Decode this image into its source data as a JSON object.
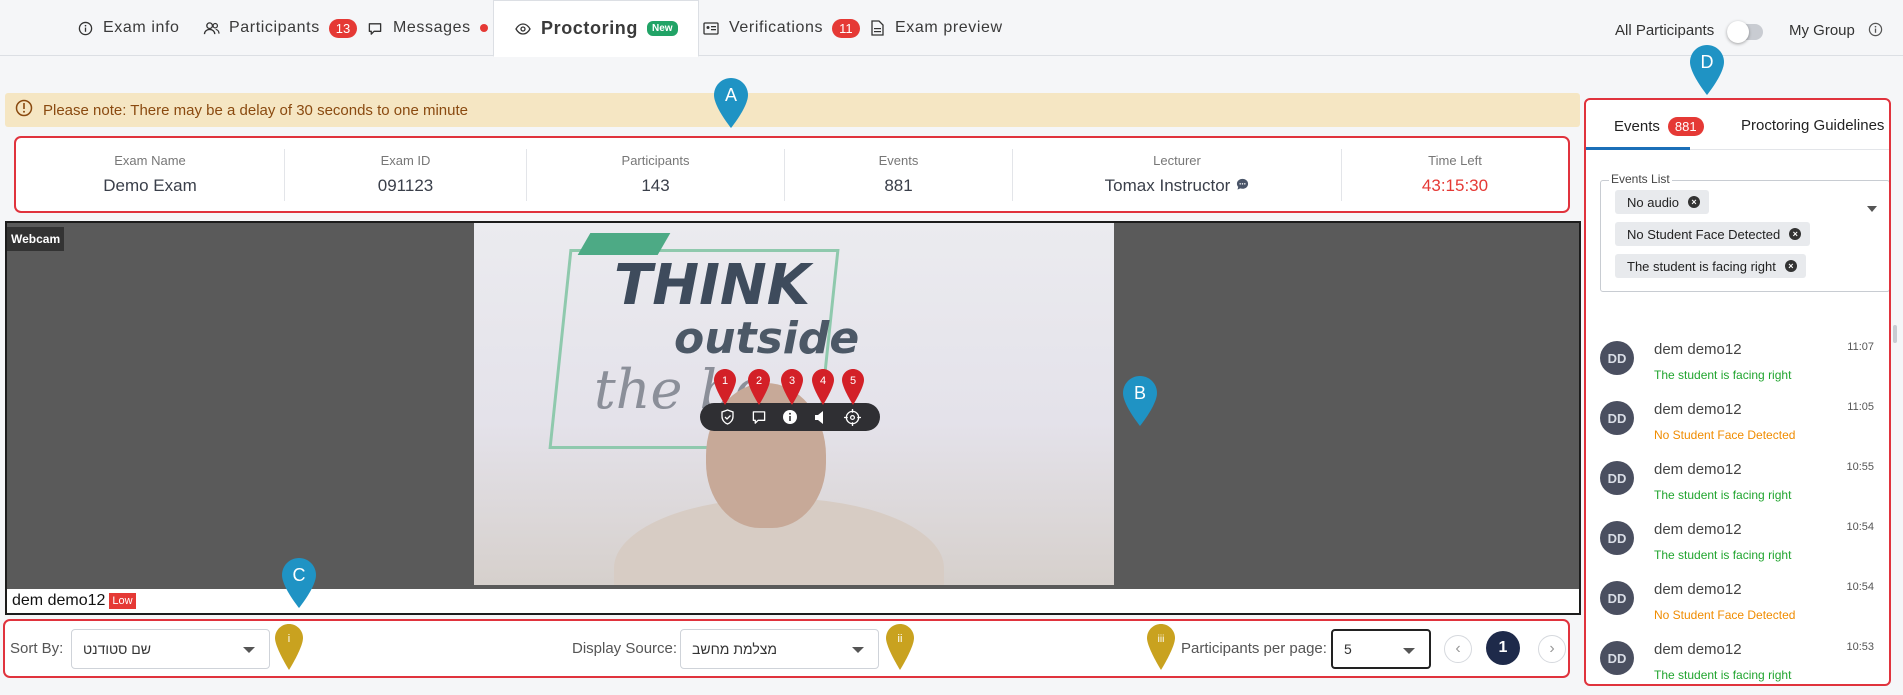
{
  "nav": {
    "tabs": [
      {
        "label": "Exam info",
        "icon": "info-circle-icon"
      },
      {
        "label": "Participants",
        "icon": "users-icon",
        "badge": "13"
      },
      {
        "label": "Messages",
        "icon": "chat-icon",
        "dot": true
      },
      {
        "label": "Proctoring",
        "icon": "eye-icon",
        "badge": "New",
        "active": true
      },
      {
        "label": "Verifications",
        "icon": "id-card-icon",
        "badge": "11"
      },
      {
        "label": "Exam preview",
        "icon": "document-icon"
      }
    ],
    "toggle_left": "All Participants",
    "toggle_right": "My Group"
  },
  "notice": {
    "text": "Please note: There may be a delay of 30 seconds to one minute"
  },
  "exam": {
    "name_label": "Exam Name",
    "name": "Demo Exam",
    "id_label": "Exam ID",
    "id": "091123",
    "participants_label": "Participants",
    "participants": "143",
    "events_label": "Events",
    "events": "881",
    "lecturer_label": "Lecturer",
    "lecturer": "Tomax Instructor",
    "time_label": "Time Left",
    "time_left": "43:15:30"
  },
  "webcam": {
    "tag": "Webcam",
    "student_name": "dem demo12",
    "quality": "Low",
    "sticker_line1": "THINK",
    "sticker_line2": "outside",
    "sticker_line3": "the bo"
  },
  "controls_pins": [
    "1",
    "2",
    "3",
    "4",
    "5"
  ],
  "area_pins": {
    "a": "A",
    "b": "B",
    "c": "C",
    "d": "D"
  },
  "bottom": {
    "sort_label": "Sort By:",
    "sort_value": "שם סטודנט",
    "source_label": "Display Source:",
    "source_value": "מצלמת מחשב",
    "per_page_label": "Participants per page:",
    "per_page_value": "5",
    "page": "1",
    "pins": [
      "i",
      "ii",
      "iii"
    ]
  },
  "panel": {
    "tab_events": "Events",
    "events_badge": "881",
    "tab_guidelines": "Proctoring Guidelines",
    "events_list_label": "Events List",
    "chips": [
      "No audio",
      "No Student Face Detected",
      "The student is facing right"
    ],
    "events": [
      {
        "initials": "DD",
        "name": "dem demo12",
        "time": "11:07",
        "msg": "The student is facing right",
        "color": "green"
      },
      {
        "initials": "DD",
        "name": "dem demo12",
        "time": "11:05",
        "msg": "No Student Face Detected",
        "color": "orange"
      },
      {
        "initials": "DD",
        "name": "dem demo12",
        "time": "10:55",
        "msg": "The student is facing right",
        "color": "green"
      },
      {
        "initials": "DD",
        "name": "dem demo12",
        "time": "10:54",
        "msg": "The student is facing right",
        "color": "green"
      },
      {
        "initials": "DD",
        "name": "dem demo12",
        "time": "10:54",
        "msg": "No Student Face Detected",
        "color": "orange"
      },
      {
        "initials": "DD",
        "name": "dem demo12",
        "time": "10:53",
        "msg": "The student is facing right",
        "color": "green"
      }
    ]
  },
  "colors": {
    "accent_red": "#e53935",
    "pin_blue": "#1f93c4",
    "pin_gold": "#c9a21f",
    "pin_red": "#d32027",
    "green": "#21a52f",
    "orange": "#f08c00"
  }
}
